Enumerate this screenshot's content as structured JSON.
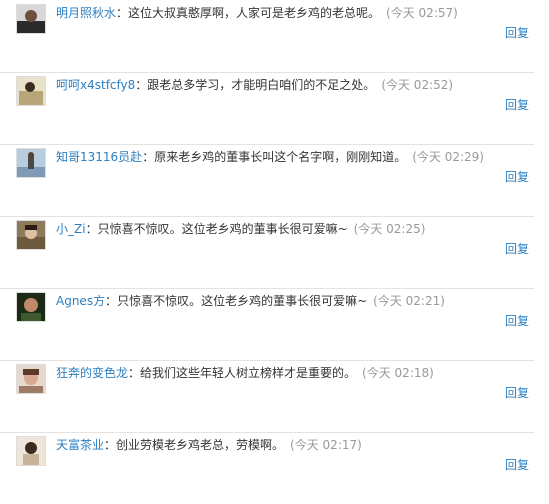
{
  "comments": [
    {
      "name": "明月照秋水",
      "text": "这位大叔真憨厚啊，人家可是老乡鸡的老总呢。",
      "time": "(今天 02:57)",
      "reply": "回复",
      "avatar_color": "#2a2a2a"
    },
    {
      "name": "呵呵x4stfcfy8",
      "text": "跟老总多学习，才能明白咱们的不足之处。",
      "time": "(今天 02:52)",
      "reply": "回复",
      "avatar_color": "#b9a57a"
    },
    {
      "name": "知哥13116员赴",
      "text": "原来老乡鸡的董事长叫这个名字啊，刚刚知道。",
      "time": "(今天 02:29)",
      "reply": "回复",
      "avatar_color": "#7d9bb8"
    },
    {
      "name": "小_Zi",
      "text": "只惊喜不惊叹。这位老乡鸡的董事长很可爱嘛~",
      "time": "(今天 02:25)",
      "reply": "回复",
      "avatar_color": "#6e5a3c"
    },
    {
      "name": "Agnes方",
      "text": "只惊喜不惊叹。这位老乡鸡的董事长很可爱嘛~",
      "time": "(今天 02:21)",
      "reply": "回复",
      "avatar_color": "#3d5a2c"
    },
    {
      "name": "狂奔的变色龙",
      "text": "给我们这些年轻人树立榜样才是重要的。",
      "time": "(今天 02:18)",
      "reply": "回复",
      "avatar_color": "#a07a66"
    },
    {
      "name": "天富茶业",
      "text": "创业劳模老乡鸡老总，劳模啊。",
      "time": "(今天 02:17)",
      "reply": "回复",
      "avatar_color": "#c8b39a"
    }
  ]
}
